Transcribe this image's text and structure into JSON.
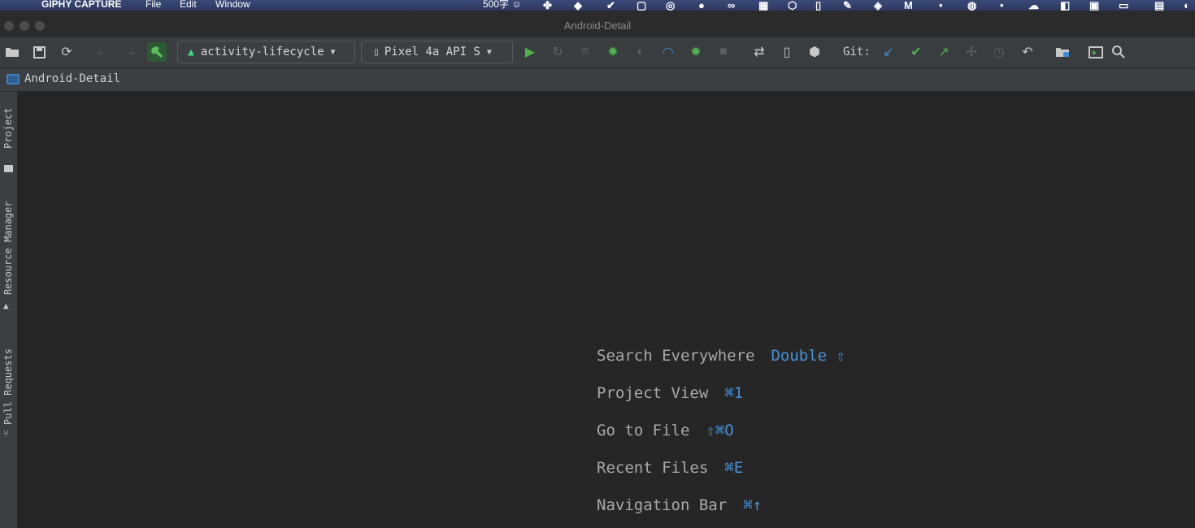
{
  "menubar": {
    "app_name": "GIPHY CAPTURE",
    "menus": [
      "File",
      "Edit",
      "Window"
    ],
    "status_text": "500字 ☺"
  },
  "window": {
    "title": "Android-Detail"
  },
  "toolbar": {
    "run_config": "activity-lifecycle",
    "device": "Pixel 4a API S",
    "git_label": "Git:"
  },
  "navbar": {
    "project_name": "Android-Detail"
  },
  "sidebar": {
    "tabs": [
      "Project",
      "Resource Manager",
      "Pull Requests"
    ]
  },
  "editor": {
    "hints": [
      {
        "label": "Search Everywhere",
        "shortcut": "Double ⇧"
      },
      {
        "label": "Project View",
        "shortcut": "⌘1"
      },
      {
        "label": "Go to File",
        "shortcut": "⇧⌘O"
      },
      {
        "label": "Recent Files",
        "shortcut": "⌘E"
      },
      {
        "label": "Navigation Bar",
        "shortcut": "⌘↑"
      }
    ]
  },
  "colors": {
    "accent": "#4a90d9",
    "run_green": "#4fb04f",
    "editor_bg": "#262626"
  }
}
